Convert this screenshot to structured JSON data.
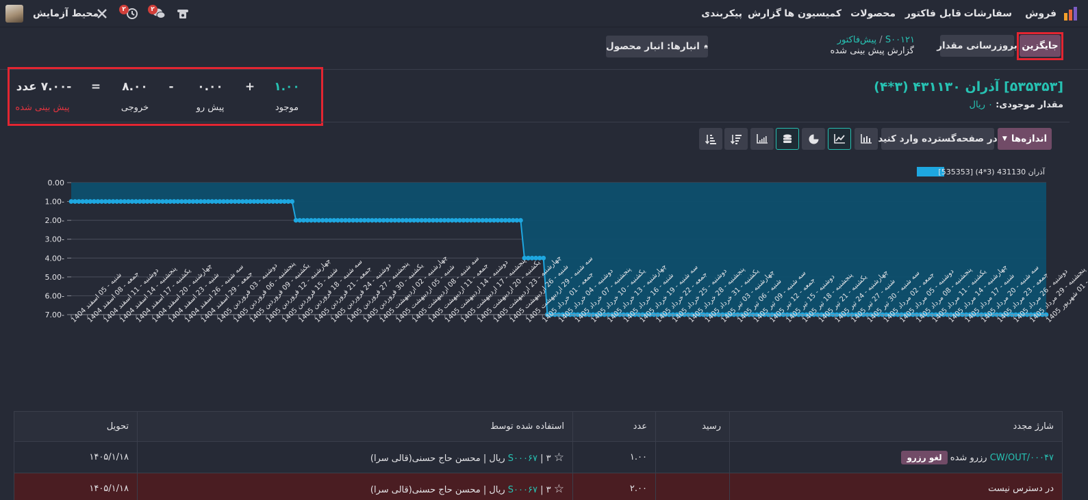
{
  "navbar": {
    "app_name": "فروش",
    "menu": [
      "سفارشات",
      "قابل فاکتور",
      "محصولات",
      "کمیسیون ها",
      "گزارش",
      "پیکربندی"
    ],
    "activity_badge": "۲",
    "messages_badge": "۲",
    "company": "محیط آزمایش"
  },
  "control": {
    "replace_button": "جایگزین",
    "update_qty_button": "بروزرسانی مقدار",
    "breadcrumb_root": "S۰۰۱۲۱",
    "breadcrumb_sep": "/",
    "breadcrumb_parent": "پیش‌فاکتور",
    "breadcrumb_current": "گزارش پیش بینی شده",
    "warehouse_button": "انبارها: انبار محصول"
  },
  "summary": {
    "on_hand_value": "۱.۰۰",
    "on_hand_label": "موجود",
    "plus": "+",
    "incoming_value": "۰.۰۰",
    "incoming_label": "پیش رو",
    "minus": "-",
    "outgoing_value": "۸.۰۰",
    "outgoing_label": "خروجی",
    "equals": "=",
    "forecast_value": "-۷.۰۰ عدد",
    "forecast_label": "پیش بینی شده"
  },
  "product": {
    "title": "[۵۳۵۳۵۳] آذران ۴۳۱۱۳۰ (۳*۴)",
    "stock_label": "مقدار موجودی:",
    "stock_value": "۰ ریال"
  },
  "toolbar": {
    "measures_label": "اندازه‌ها",
    "insert_label": "در صفحه‌گسترده وارد کنید"
  },
  "colors": {
    "accent": "#27c2b3",
    "purple": "#714b67",
    "danger": "#e32531",
    "chart_line": "#1ea7e0",
    "chart_fill": "#0d4f6e"
  },
  "chart_data": {
    "type": "line",
    "legend": "[535353] آذران 431130 (3*4)",
    "y_ticks": [
      "0.00",
      "1.00-",
      "2.00-",
      "3.00-",
      "4.00-",
      "5.00-",
      "6.00-",
      "7.00-"
    ],
    "ylim": [
      -7,
      0
    ],
    "x_tick_labels": [
      "شنبه - 05 اسفند 1404",
      "جمعه - 08 اسفند 1404",
      "دوشنبه - 11 اسفند 1404",
      "پنجشنبه - 14 اسفند 1404",
      "یکشنبه - 17 اسفند 1404",
      "چهارشنبه - 20 اسفند 1404",
      "شنبه - 23 اسفند 1404",
      "سه شنبه - 26 اسفند 1404",
      "جمعه - 29 اسفند 1404",
      "دوشنبه - 03 فروردین 1405",
      "پنجشنبه - 06 فروردین 1405",
      "یکشنبه - 09 فروردین 1405",
      "چهارشنبه - 12 فروردین 1405",
      "شنبه - 15 فروردین 1405",
      "سه شنبه - 18 فروردین 1405",
      "جمعه - 21 فروردین 1405",
      "دوشنبه - 24 فروردین 1405",
      "پنجشنبه - 27 فروردین 1405",
      "یکشنبه - 30 فروردین 1405",
      "چهارشنبه - 02 اردیبهشت 1405",
      "شنبه - 05 اردیبهشت 1405",
      "سه شنبه - 08 اردیبهشت 1405",
      "جمعه - 11 اردیبهشت 1405",
      "دوشنبه - 14 اردیبهشت 1405",
      "پنجشنبه - 17 اردیبهشت 1405",
      "یکشنبه - 20 اردیبهشت 1405",
      "چهارشنبه - 23 اردیبهشت 1405",
      "شنبه - 26 اردیبهشت 1405",
      "سه شنبه - 29 اردیبهشت 1405",
      "جمعه - 01 خرداد 1405",
      "دوشنبه - 04 خرداد 1405",
      "پنجشنبه - 07 خرداد 1405",
      "یکشنبه - 10 خرداد 1405",
      "چهارشنبه - 13 خرداد 1405",
      "شنبه - 16 خرداد 1405",
      "سه شنبه - 19 خرداد 1405",
      "جمعه - 22 خرداد 1405",
      "دوشنبه - 25 خرداد 1405",
      "پنجشنبه - 28 خرداد 1405",
      "یکشنبه - 31 خرداد 1405",
      "چهارشنبه - 03 تیر 1405",
      "شنبه - 06 تیر 1405",
      "سه شنبه - 09 تیر 1405",
      "جمعه - 12 تیر 1405",
      "دوشنبه - 15 تیر 1405",
      "پنجشنبه - 18 تیر 1405",
      "یکشنبه - 21 تیر 1405",
      "چهارشنبه - 24 تیر 1405",
      "شنبه - 27 تیر 1405",
      "سه شنبه - 30 تیر 1405",
      "جمعه - 02 مرداد 1405",
      "دوشنبه - 05 مرداد 1405",
      "پنجشنبه - 08 مرداد 1405",
      "یکشنبه - 11 مرداد 1405",
      "چهارشنبه - 14 مرداد 1405",
      "شنبه - 17 مرداد 1405",
      "سه شنبه - 20 مرداد 1405",
      "جمعه - 23 مرداد 1405",
      "دوشنبه - 26 مرداد 1405",
      "پنجشنبه - 29 مرداد 1405",
      "یکشنبه - 01 شهریور 1405"
    ],
    "segments": [
      {
        "from_point": 0,
        "to_point": 58,
        "value": -1
      },
      {
        "from_point": 59,
        "to_point": 118,
        "value": -2
      },
      {
        "from_point": 119,
        "to_point": 124,
        "value": -4
      },
      {
        "from_point": 125,
        "to_point": 256,
        "value": -7
      }
    ]
  },
  "table": {
    "headers": [
      "شارژ مجدد",
      "رسید",
      "عدد",
      "استفاده شده توسط",
      "تحویل"
    ],
    "rows": [
      {
        "ref": "CW/OUT/۰۰۰۴۷",
        "status": "رزرو شده",
        "action": "لغو رزرو",
        "receipt": "",
        "qty": "۱.۰۰",
        "star": "☆",
        "used_num": "۳",
        "used_sep": "|",
        "used_so": "S۰۰۰۶۷",
        "used_rest": "ریال | محسن حاج حسنی(قالی سرا)",
        "delivery": "۱۴۰۵/۱/۱۸"
      },
      {
        "ref": "در دسترس نیست",
        "status": "",
        "action": "",
        "receipt": "",
        "qty": "۲.۰۰",
        "star": "☆",
        "used_num": "۳",
        "used_sep": "|",
        "used_so": "S۰۰۰۶۷",
        "used_rest": "ریال | محسن حاج حسنی(قالی سرا)",
        "delivery": "۱۴۰۵/۱/۱۸"
      }
    ]
  }
}
